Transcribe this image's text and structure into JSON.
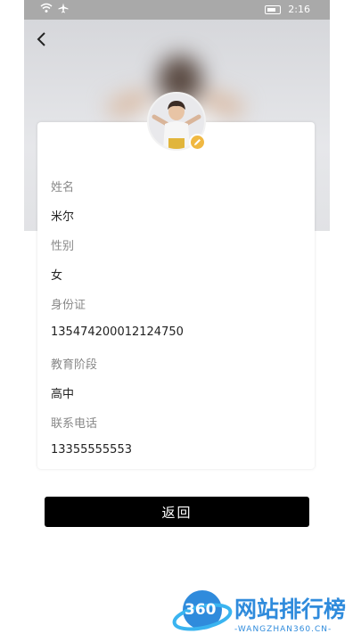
{
  "status_bar": {
    "time": "2:16"
  },
  "profile": {
    "fields": [
      {
        "label": "姓名",
        "value": "米尔"
      },
      {
        "label": "性别",
        "value": "女"
      },
      {
        "label": "身份证",
        "value": "135474200012124750"
      },
      {
        "label": "教育阶段",
        "value": "高中"
      },
      {
        "label": "联系电话",
        "value": "13355555553"
      }
    ]
  },
  "actions": {
    "return_label": "返回"
  },
  "watermark": {
    "brand_number": "360",
    "brand_name": "网站排行榜",
    "brand_url": "-WANGZHAN360.CN-"
  },
  "colors": {
    "button_bg": "#000000",
    "edit_badge": "#f0b842",
    "watermark_blue": "#2f8bdc"
  }
}
